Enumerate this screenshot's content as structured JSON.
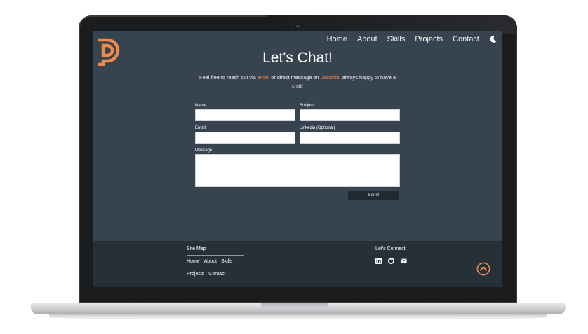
{
  "nav": {
    "items": [
      "Home",
      "About",
      "Skills",
      "Projects",
      "Contact"
    ]
  },
  "icons": {
    "logo": "dp-logo",
    "theme": "moon-icon",
    "social": [
      "linkedin-icon",
      "github-icon",
      "mail-icon"
    ],
    "scroll_top": "chevron-up-circle-icon"
  },
  "colors": {
    "accent": "#f08a4b",
    "page_bg": "#37434f",
    "footer_bg": "#253038"
  },
  "hero": {
    "title": "Let's Chat!",
    "intro_prefix": "Feel free to reach out via ",
    "intro_email": "email",
    "intro_middle": " or direct message on ",
    "intro_linkedin": "Linkedin",
    "intro_suffix": ", always happy to have a chat!"
  },
  "form": {
    "name_label": "Name",
    "subject_label": "Subject",
    "email_label": "Email",
    "linkedin_label": "Linkedin (Optional)",
    "message_label": "Message",
    "send_label": "Send!"
  },
  "footer": {
    "sitemap_title": "Site Map",
    "sitemap_links": [
      "Home",
      "About",
      "Skills",
      "Projects",
      "Contact"
    ],
    "connect_title": "Let's Connect"
  }
}
